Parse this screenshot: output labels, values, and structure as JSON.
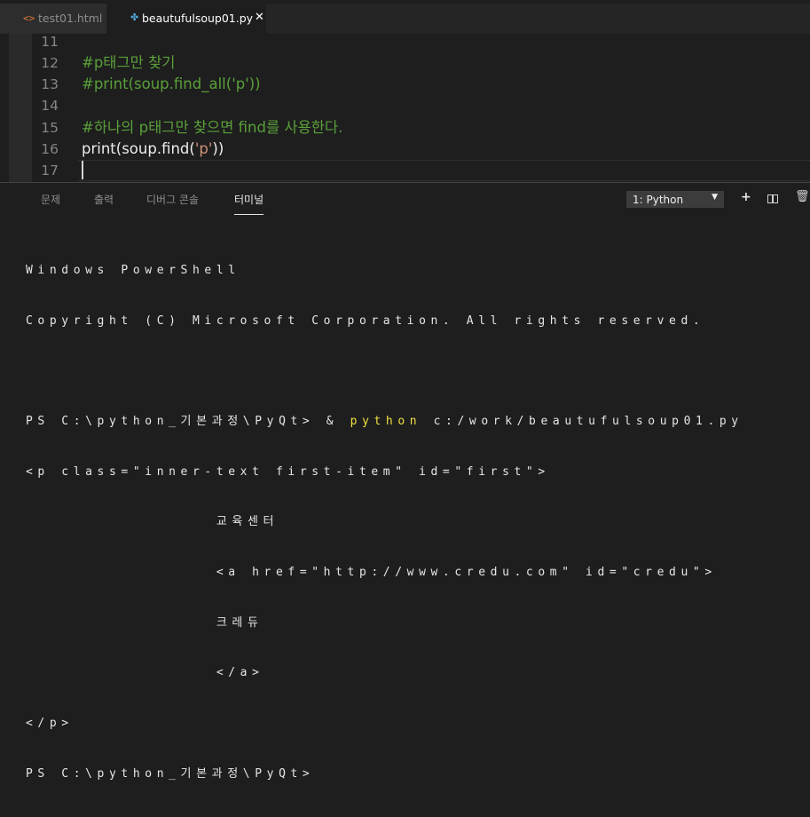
{
  "tabs": [
    {
      "icon": "html-file-icon",
      "label": "test01.html",
      "active": false
    },
    {
      "icon": "python-file-icon",
      "label": "beautufulsoup01.py",
      "active": true,
      "close": "✕"
    }
  ],
  "editor": {
    "lines": [
      {
        "num": "11",
        "code": ""
      },
      {
        "num": "12",
        "code": "#p태그만 찾기"
      },
      {
        "num": "13",
        "code": "#print(soup.find_all('p'))"
      },
      {
        "num": "14",
        "code": ""
      },
      {
        "num": "15",
        "code": "#하나의 p태그만 찾으면 find를 사용한다."
      },
      {
        "num": "16",
        "code_parts": [
          "print(soup.find(",
          "'p'",
          "))"
        ]
      },
      {
        "num": "17",
        "code": ""
      }
    ]
  },
  "panel": {
    "tabs": [
      "문제",
      "출력",
      "디버그 콘솔",
      "터미널"
    ],
    "active_tab": "터미널",
    "terminal_select": "1: Python",
    "add_button": "+",
    "trash_button": "🗑"
  },
  "terminal": {
    "lines": [
      "Windows PowerShell",
      "Copyright (C) Microsoft Corporation. All rights reserved.",
      "",
      "",
      "<p class=\"inner-text first-item\" id=\"first\">",
      "                교육센터",
      "                <a href=\"http://www.credu.com\" id=\"credu\">",
      "                크레듀",
      "                </a>",
      "</p>",
      "PS C:\\python_기본과정\\PyQt>"
    ],
    "prompt_line": {
      "prompt": "PS C:\\python_기본과정\\PyQt> & ",
      "cmd": "python",
      "args": " c:/work/beautufulsoup01.py"
    }
  },
  "colors": {
    "comment": "#5aa03a",
    "string": "#ce9178",
    "terminal_command": "#f0e040",
    "background": "#1e1e1e"
  }
}
